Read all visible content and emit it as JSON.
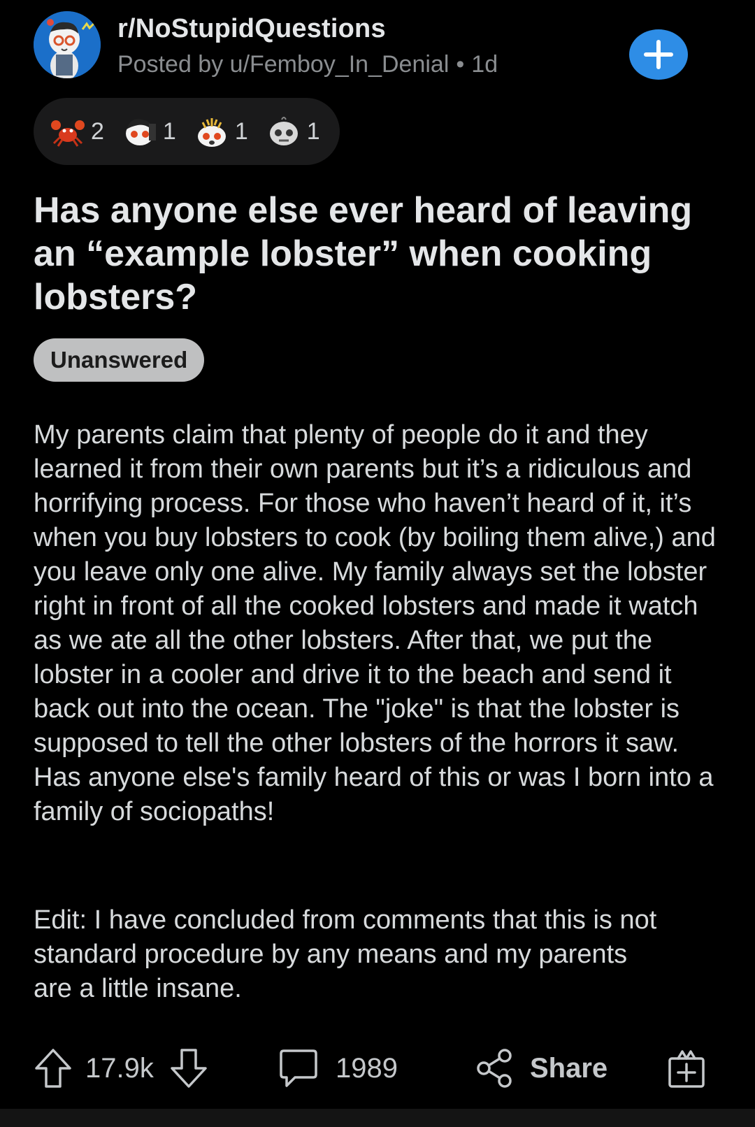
{
  "post": {
    "subreddit": "r/NoStupidQuestions",
    "posted_by": "Posted by u/Femboy_In_Denial",
    "separator": "•",
    "age": "1d",
    "title": "Has anyone else ever heard of leaving an “example lobster” when cooking lobsters?",
    "flair": "Unanswered",
    "body": "My parents claim that plenty of people do it and they learned it from their own parents but it’s a ridiculous and horrifying process. For those who haven’t heard of it, it’s when you buy lobsters to cook (by boiling them alive,) and you leave only one alive. My family always set the lobster right in front of all the cooked lobsters and made it watch as we ate all the other lobsters. After that, we put the lobster in a cooler and drive it to the beach and send it back out into the ocean. The \"joke\" is that the lobster is supposed to tell the other lobsters of the horrors it saw. Has anyone else's family heard of this or was I born into a family of sociopaths!",
    "edit": "Edit: I have concluded from comments that this is not standard procedure by any means and my parents are a little insane."
  },
  "awards": [
    {
      "icon": "lobster-award-icon",
      "count": "2"
    },
    {
      "icon": "faceplant-award-icon",
      "count": "1"
    },
    {
      "icon": "mind-blown-award-icon",
      "count": "1"
    },
    {
      "icon": "skull-award-icon",
      "count": "1"
    }
  ],
  "actions": {
    "score": "17.9k",
    "comments": "1989",
    "share_label": "Share"
  },
  "colors": {
    "background": "#000000",
    "accent_blue": "#2e8de6",
    "flair_bg": "#bfc0c1"
  }
}
